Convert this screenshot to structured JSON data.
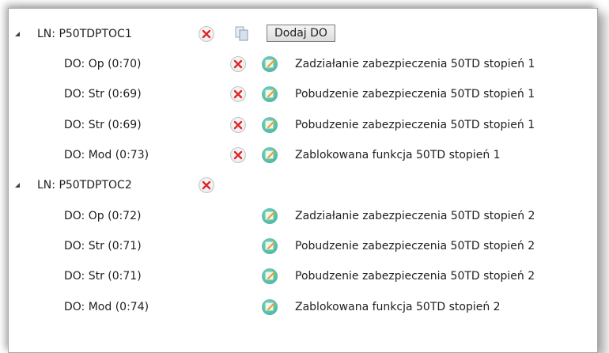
{
  "tree": {
    "add_do_label": "Dodaj DO",
    "nodes": [
      {
        "label": "LN: P50TDPTOC1",
        "children": [
          {
            "label": "DO: Op (0:70)",
            "description": "Zadziałanie zabezpieczenia 50TD stopień 1"
          },
          {
            "label": "DO: Str (0:69)",
            "description": "Pobudzenie zabezpieczenia 50TD stopień 1"
          },
          {
            "label": "DO: Str (0:69)",
            "description": "Pobudzenie zabezpieczenia 50TD stopień 1"
          },
          {
            "label": "DO: Mod (0:73)",
            "description": "Zablokowana funkcja 50TD stopień 1"
          }
        ]
      },
      {
        "label": "LN: P50TDPTOC2",
        "children": [
          {
            "label": "DO: Op (0:72)",
            "description": "Zadziałanie zabezpieczenia 50TD stopień 2"
          },
          {
            "label": "DO: Str (0:71)",
            "description": "Pobudzenie zabezpieczenia 50TD stopień 2"
          },
          {
            "label": "DO: Str (0:71)",
            "description": "Pobudzenie zabezpieczenia 50TD stopień 2"
          },
          {
            "label": "DO: Mod (0:74)",
            "description": "Zablokowana funkcja 50TD stopień 2"
          }
        ]
      }
    ]
  },
  "colors": {
    "delete_icon": "#e0242a",
    "edit_icon": "#4fb9a2"
  }
}
